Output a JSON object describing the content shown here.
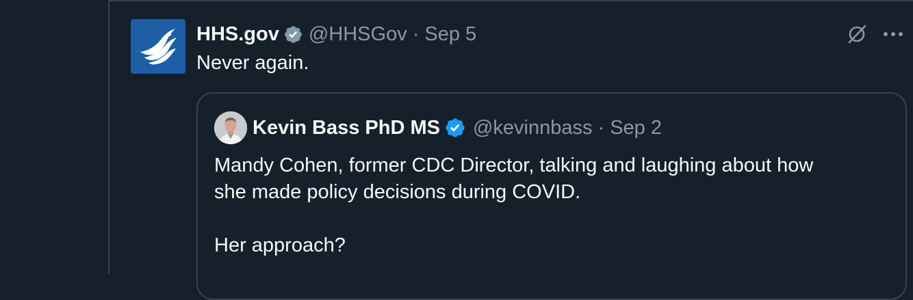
{
  "tweet": {
    "display_name": "HHS.gov",
    "handle": "@HHSGov",
    "separator": "·",
    "date": "Sep 5",
    "text": "Never again.",
    "avatar_icon": "hhs-eagle-logo-icon",
    "badge_icon": "gray-verified-badge-icon",
    "actions": [
      "grok-icon",
      "more-options-icon"
    ]
  },
  "quote": {
    "display_name": "Kevin Bass PhD MS",
    "handle": "@kevinnbass",
    "separator": "·",
    "date": "Sep 2",
    "badge_icon": "blue-verified-badge-icon",
    "text_line1": "Mandy Cohen, former CDC Director, talking and laughing about how",
    "text_line2": "she made policy decisions during COVID.",
    "text_line3": "Her approach?"
  },
  "colors": {
    "background": "#15202b",
    "border": "#38444d",
    "text_primary": "#f7f9f9",
    "text_secondary": "#8b98a5",
    "verified_blue": "#1d9bf0",
    "verified_gray": "#829aab",
    "hhs_blue": "#1d5ea6"
  }
}
